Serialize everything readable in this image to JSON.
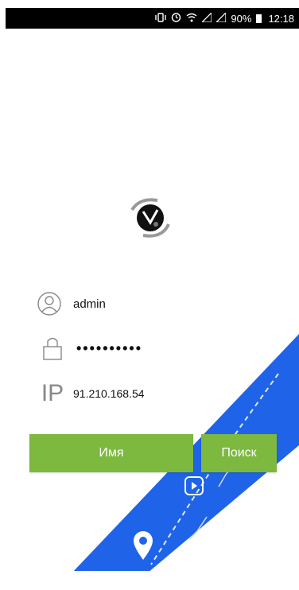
{
  "status_bar": {
    "battery_percent": "90%",
    "time": "12:18",
    "icons": [
      "vibrate-icon",
      "alarm-icon",
      "wifi-icon",
      "signal-icon",
      "signal-icon",
      "battery-icon"
    ]
  },
  "login": {
    "username": "admin",
    "password_mask": "••••••••••",
    "ip_label": "IP",
    "ip_address": "91.210.168.54"
  },
  "buttons": {
    "name_label": "Имя",
    "search_label": "Поиск"
  },
  "colors": {
    "accent_green": "#7db83f",
    "road_blue": "#1f63e8",
    "statusbar_bg": "#000000"
  }
}
